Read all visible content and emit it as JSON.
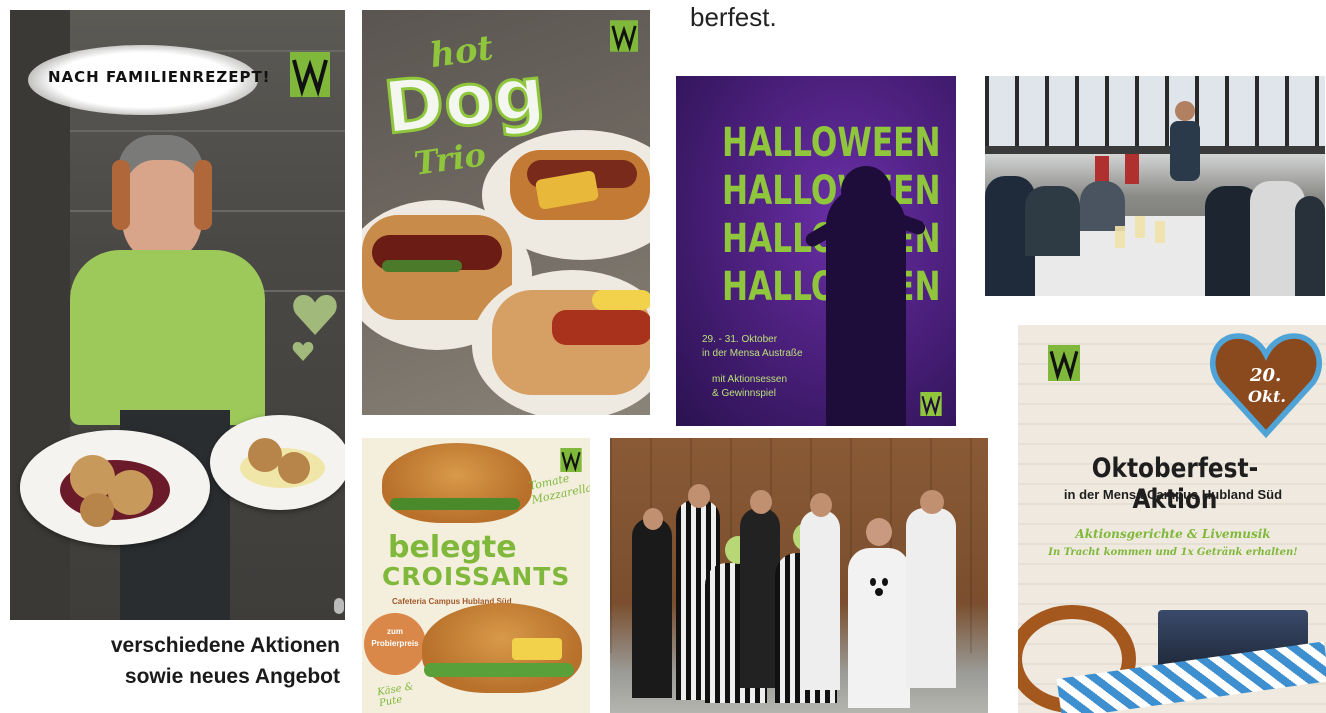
{
  "header_fragment": "berfest.",
  "caption": {
    "line1": "verschiedene Aktionen",
    "line2": "sowie neues Angebot"
  },
  "family_recipe": {
    "label": "NACH FAMILIENREZEPT!"
  },
  "hotdog": {
    "word1": "hot",
    "word2": "Dog",
    "word3": "Trio"
  },
  "halloween": {
    "rows": [
      "HALLOWEEN",
      "HALLOWEEN",
      "HALLOWEEN",
      "HALLOWEEN"
    ],
    "dates": "29. - 31. Oktober",
    "location": "in der Mensa Austraße",
    "extra1": "mit Aktionsessen",
    "extra2": "& Gewinnspiel"
  },
  "croissant": {
    "title1": "belegte",
    "title2": "CROISSANTS",
    "subtitle": "Cafeteria Campus Hubland Süd",
    "badge1": "zum",
    "badge2": "Probierpreis",
    "flavor1": "Tomate Mozzarella",
    "flavor2": "Käse & Pute"
  },
  "oktoberfest": {
    "heart_line1": "20.",
    "heart_line2": "Okt.",
    "title": "Oktoberfest-Aktion",
    "subtitle": "in der Mensa Campus Hubland Süd",
    "line1": "Aktionsgerichte & Livemusik",
    "line2": "In Tracht kommen und 1x Getränk erhalten!"
  },
  "colors": {
    "brand_green": "#7fb83a",
    "halloween_purple": "#4a1f7a",
    "halloween_green": "#8fc63c",
    "croissant_orange": "#d9884a"
  }
}
